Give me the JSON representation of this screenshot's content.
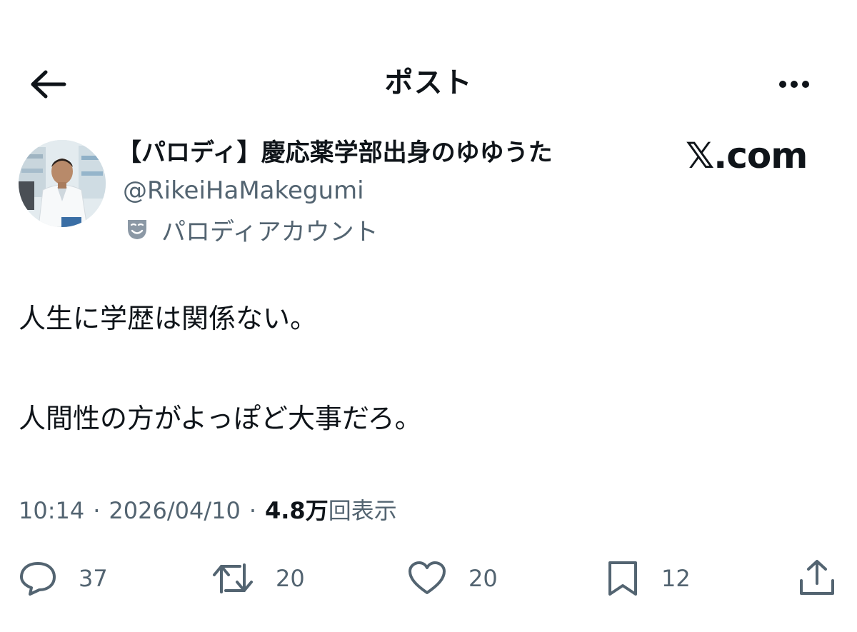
{
  "header": {
    "title": "ポスト"
  },
  "author": {
    "display_name": "【パロディ】慶応薬学部出身のゆゆうた",
    "handle": "@RikeiHaMakegumi",
    "parody_label": "パロディアカウント"
  },
  "brand": "𝕏.com",
  "tweet": {
    "lines": [
      "人生に学歴は関係ない。",
      "人間性の方がよっぽど大事だろ。"
    ]
  },
  "meta": {
    "time": "10:14",
    "separator": "·",
    "date": "2026/04/10",
    "views_count": "4.8万",
    "views_label": "回表示"
  },
  "actions": {
    "replies": "37",
    "reposts": "20",
    "likes": "20",
    "bookmarks": "12"
  },
  "icons": {
    "back": "arrow-left-icon",
    "more": "more-horizontal-icon",
    "parody": "theater-mask-icon",
    "reply": "reply-bubble-icon",
    "repost": "repost-icon",
    "like": "heart-icon",
    "bookmark": "bookmark-icon",
    "share": "share-icon"
  },
  "colors": {
    "text_primary": "#0f1419",
    "text_secondary": "#536471",
    "background": "#ffffff"
  }
}
